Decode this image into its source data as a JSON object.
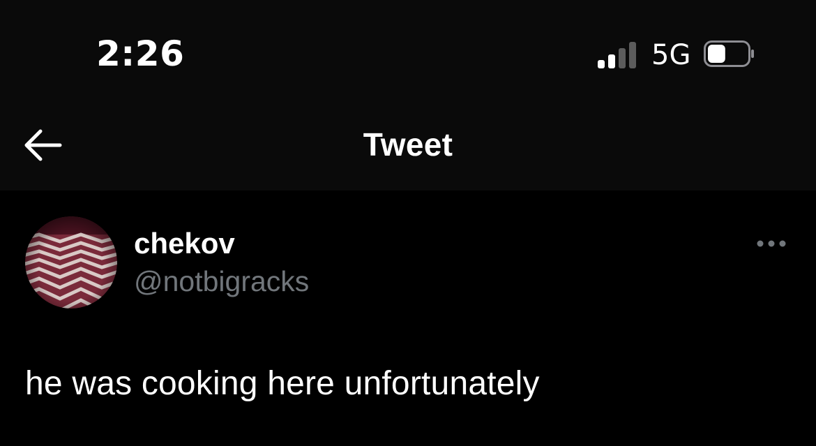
{
  "status_bar": {
    "time": "2:26",
    "network": "5G",
    "signal_icon": "cellular-signal-icon",
    "signal_bars_active": 2,
    "signal_bars_total": 4,
    "battery_icon": "battery-icon",
    "battery_level": 0.45
  },
  "nav": {
    "back_icon": "arrow-left-icon",
    "title": "Tweet"
  },
  "tweet": {
    "author": {
      "display_name": "chekov",
      "handle": "@notbigracks",
      "avatar": "avatar-zigzag-floor-image"
    },
    "more_icon": "more-options-icon",
    "text": "he was cooking here unfortunately"
  },
  "colors": {
    "background": "#000000",
    "header_background": "#0a0a0a",
    "primary_text": "#ffffff",
    "secondary_text": "#71767b",
    "inactive_signal": "#5c5c5c"
  }
}
